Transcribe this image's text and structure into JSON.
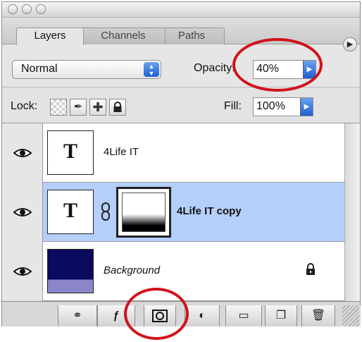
{
  "panel": {
    "tabs": [
      {
        "label": "Layers",
        "active": true
      },
      {
        "label": "Channels",
        "active": false
      },
      {
        "label": "Paths",
        "active": false
      }
    ],
    "menu_icon": "play-circle-icon"
  },
  "blend": {
    "mode": "Normal",
    "opacity_label": "Opacity:",
    "opacity_value": "40%"
  },
  "lock": {
    "label": "Lock:",
    "icons": [
      "transparency-checker-icon",
      "brush-icon",
      "move-arrows-icon",
      "padlock-icon"
    ],
    "fill_label": "Fill:",
    "fill_value": "100%"
  },
  "layers": [
    {
      "name": "4Life IT",
      "kind": "text",
      "thumb_glyph": "T",
      "selected": false
    },
    {
      "name": "4Life IT copy",
      "kind": "text-with-mask",
      "thumb_glyph": "T",
      "selected": true
    },
    {
      "name": "Background",
      "kind": "image",
      "locked": true,
      "selected": false
    }
  ],
  "toolbar": {
    "buttons": [
      "link-icon",
      "layer-style-icon",
      "layer-mask-icon",
      "adjustment-layer-icon",
      "folder-icon",
      "new-layer-icon",
      "trash-icon"
    ]
  },
  "colors": {
    "annotation": "#d0121b",
    "selection": "#b4cffa",
    "background_thumb_top": "#0a0b5e",
    "background_thumb_bottom": "#8b86c9"
  }
}
